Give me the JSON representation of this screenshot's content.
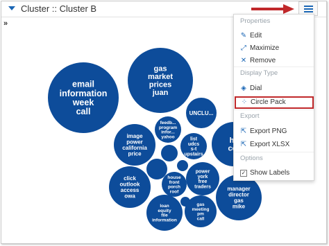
{
  "panel": {
    "title": "Cluster :: Cluster B",
    "expand_glyph": "»"
  },
  "menu": {
    "sections": [
      {
        "label": "Properties",
        "items": [
          {
            "label": "Edit",
            "icon": "pencil-icon"
          },
          {
            "label": "Maximize",
            "icon": "maximize-icon"
          },
          {
            "label": "Remove",
            "icon": "close-icon"
          }
        ]
      },
      {
        "label": "Display Type",
        "items": [
          {
            "label": "Dial",
            "icon": "stack-icon"
          },
          {
            "label": "Circle Pack",
            "icon": "circle-pack-icon",
            "selected": true
          }
        ]
      },
      {
        "label": "Export",
        "items": [
          {
            "label": "Export PNG",
            "icon": "export-icon"
          },
          {
            "label": "Export XLSX",
            "icon": "export-icon"
          }
        ]
      },
      {
        "label": "Options",
        "items": [
          {
            "label": "Show Labels",
            "icon": "checkbox-icon",
            "checked": true
          }
        ]
      }
    ]
  },
  "circle_pack": {
    "color": "#0d4c9a",
    "label_color": "#ffffff",
    "circles": [
      {
        "label": "email\ninformation\nweek\ncall"
      },
      {
        "label": "gas\nmarket\nprices\njuan"
      },
      {
        "label": "UNCLU..."
      },
      {
        "label": "he\ncor"
      },
      {
        "label": "feedb...\nprogram\ninfor...\nyahoo"
      },
      {
        "label": "image\npower\ncalifornia\nprice"
      },
      {
        "label": "list\nudcs\ns-t\nupstairs"
      },
      {
        "label": ""
      },
      {
        "label": ""
      },
      {
        "label": ""
      },
      {
        "label": "power\nyork\nfree\ntraders"
      },
      {
        "label": "click\noutlook\naccess\nowa"
      },
      {
        "label": "house\nfront\nporch\nroof"
      },
      {
        "label": ""
      },
      {
        "label": "manager\ndirector\ngas\nmike"
      },
      {
        "label": "loan\nequity\nfile\ninformation"
      },
      {
        "label": "gas\nmeeting\npm\ncall"
      }
    ]
  },
  "colors": {
    "accent": "#1a66b5",
    "highlight": "#c0282a",
    "arrow": "#c0282a"
  }
}
